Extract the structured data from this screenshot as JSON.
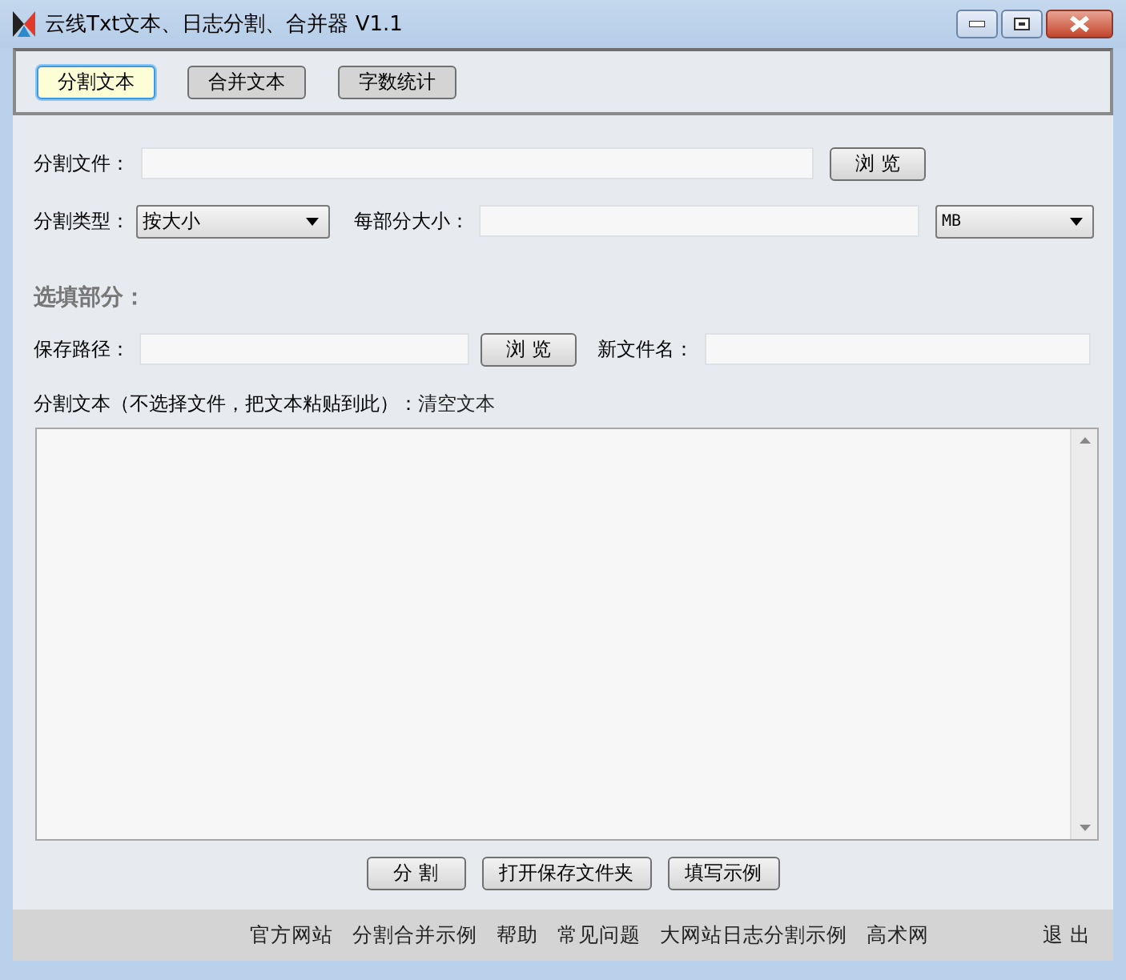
{
  "window": {
    "title": "云线Txt文本、日志分割、合并器 V1.1"
  },
  "tabs": [
    {
      "label": "分割文本",
      "selected": true
    },
    {
      "label": "合并文本",
      "selected": false
    },
    {
      "label": "字数统计",
      "selected": false
    }
  ],
  "split_file": {
    "label": "分割文件：",
    "browse": "浏 览"
  },
  "split_type": {
    "label": "分割类型：",
    "value": "按大小"
  },
  "part_size": {
    "label": "每部分大小：",
    "unit": "MB"
  },
  "optional_section": {
    "title": "选填部分："
  },
  "save_path": {
    "label": "保存路径：",
    "browse": "浏 览"
  },
  "new_filename": {
    "label": "新文件名："
  },
  "text_area": {
    "label": "分割文本（不选择文件，把文本粘贴到此）：",
    "clear_link": "清空文本"
  },
  "actions": [
    "分 割",
    "打开保存文件夹",
    "填写示例"
  ],
  "footer": {
    "links": [
      "官方网站",
      "分割合并示例",
      "帮助",
      "常见问题",
      "大网站日志分割示例",
      "高术网"
    ],
    "exit": "退 出"
  }
}
